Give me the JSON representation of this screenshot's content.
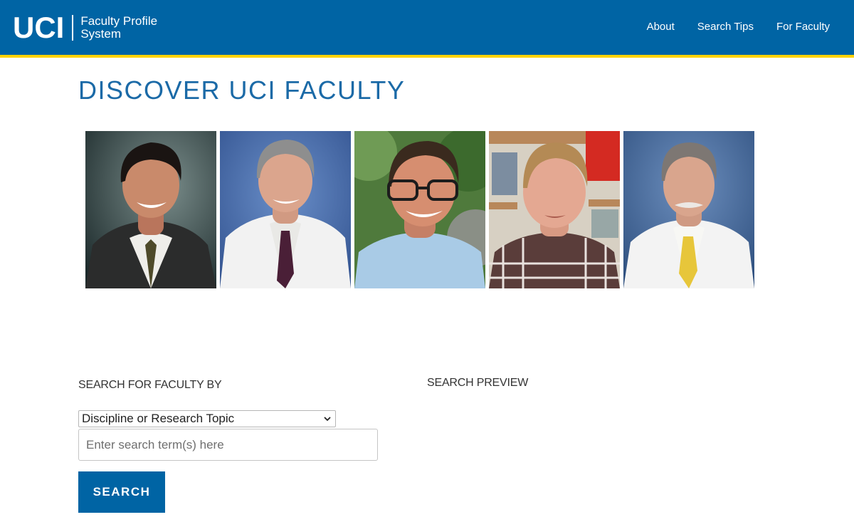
{
  "header": {
    "logo_mark": "UCI",
    "logo_line1": "Faculty Profile",
    "logo_line2": "System",
    "nav": [
      {
        "label": "About"
      },
      {
        "label": "Search Tips"
      },
      {
        "label": "For Faculty"
      }
    ]
  },
  "main": {
    "title": "DISCOVER UCI FACULTY",
    "photos": [
      {
        "icon": "faculty-portrait-1"
      },
      {
        "icon": "faculty-portrait-2"
      },
      {
        "icon": "faculty-portrait-3"
      },
      {
        "icon": "faculty-portrait-4"
      },
      {
        "icon": "faculty-portrait-5"
      }
    ]
  },
  "search": {
    "heading": "SEARCH FOR FACULTY BY",
    "select_value": "Discipline or Research Topic",
    "input_placeholder": "Enter search term(s) here",
    "input_value": "",
    "button_label": "SEARCH"
  },
  "preview": {
    "heading": "SEARCH PREVIEW"
  },
  "colors": {
    "brand_blue": "#0064a4",
    "brand_gold": "#ffd200",
    "title_blue": "#1b6aa7"
  }
}
